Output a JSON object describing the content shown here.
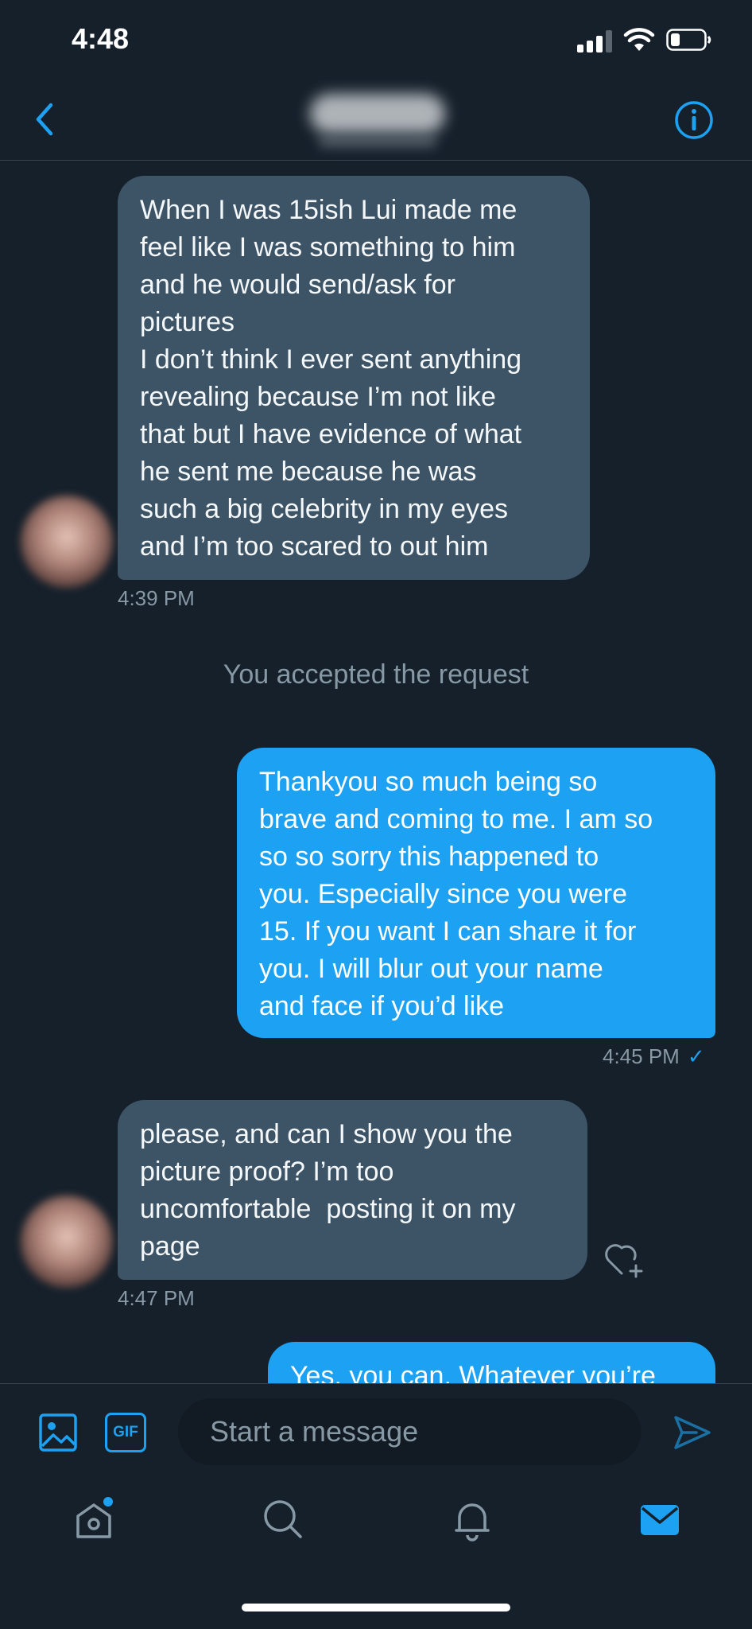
{
  "status_bar": {
    "time": "4:48"
  },
  "header": {
    "back_icon": "chevron-left-icon",
    "info_icon": "info-circle-icon"
  },
  "messages": [
    {
      "direction": "in",
      "text": "When I was 15ish Lui made me\nfeel like I was something to him\nand he would send/ask for\npictures\nI don’t think I ever sent anything\nrevealing because I’m not like\nthat but I have evidence of what\nhe sent me because he was\nsuch a big celebrity in my eyes\nand I’m too scared to out him",
      "time": "4:39 PM"
    },
    {
      "direction": "system",
      "text": "You accepted the request"
    },
    {
      "direction": "out",
      "text": "Thankyou so much being so\nbrave and coming to me. I am so\nso so sorry this happened to\nyou. Especially since you were\n15. If you want I can share it for\nyou. I will blur out your name\nand face if you’d like",
      "time": "4:45 PM",
      "status": "✓"
    },
    {
      "direction": "in",
      "text": "please, and can I show you the\npicture proof? I’m too\nuncomfortable  posting it on my\npage",
      "time": "4:47 PM"
    },
    {
      "direction": "out",
      "text": "Yes, you can. Whatever you’re"
    }
  ],
  "composer": {
    "gif_label": "GIF",
    "placeholder": "Start a message"
  },
  "tab_bar": {
    "items": [
      "home-icon",
      "search-icon",
      "notifications-icon",
      "messages-icon"
    ]
  },
  "colors": {
    "background": "#15202b",
    "accent": "#1da1f2",
    "incoming_bubble": "#3d5466",
    "secondary_text": "#8899a6"
  }
}
